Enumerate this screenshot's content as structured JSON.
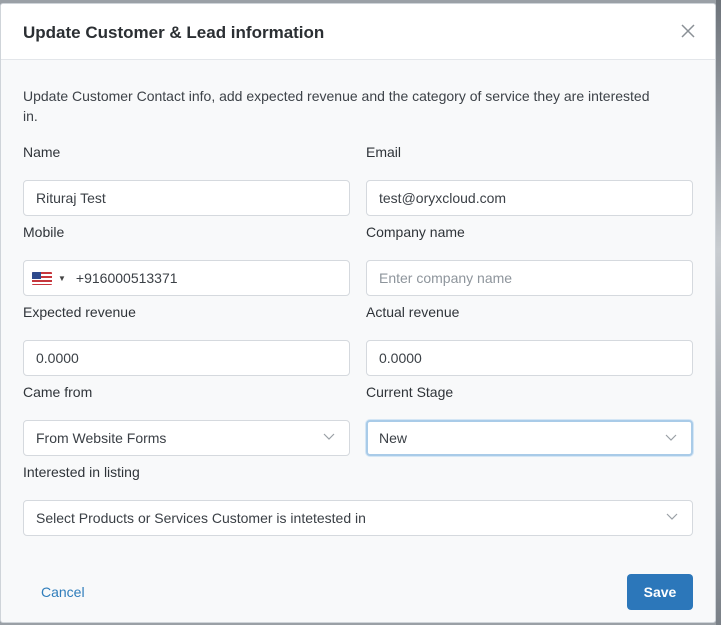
{
  "modal": {
    "title": "Update Customer & Lead information",
    "description": "Update Customer Contact info, add expected revenue and the category of service they are interested in."
  },
  "fields": {
    "name": {
      "label": "Name",
      "value": "Rituraj Test"
    },
    "email": {
      "label": "Email",
      "value": "test@oryxcloud.com"
    },
    "mobile": {
      "label": "Mobile",
      "country_flag": "us-flag-icon",
      "value": "+916000513371"
    },
    "company": {
      "label": "Company name",
      "placeholder": "Enter company name"
    },
    "expected_revenue": {
      "label": "Expected revenue",
      "value": "0.0000"
    },
    "actual_revenue": {
      "label": "Actual revenue",
      "value": "0.0000"
    },
    "came_from": {
      "label": "Came from",
      "value": "From Website Forms"
    },
    "current_stage": {
      "label": "Current Stage",
      "value": "New"
    },
    "interested_listing": {
      "label": "Interested in listing",
      "placeholder": "Select Products or Services Customer is intetested in"
    }
  },
  "footer": {
    "cancel_label": "Cancel",
    "save_label": "Save"
  },
  "colors": {
    "accent": "#2c77ba",
    "link": "#2f7dbb",
    "focus": "#a9cbe8"
  }
}
